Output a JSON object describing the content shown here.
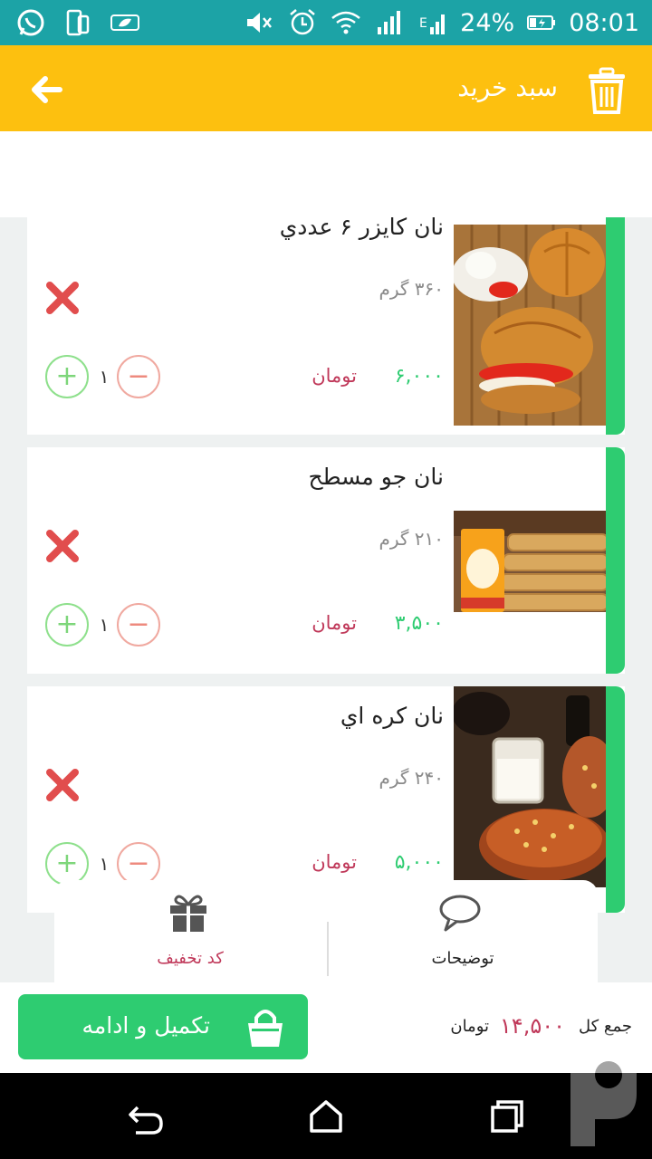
{
  "status_bar": {
    "time": "08:01",
    "battery": "24%",
    "left_icons": [
      "whatsapp-icon",
      "phone-sync-icon",
      "leaf-icon"
    ],
    "right_icons": [
      "mute-icon",
      "alarm-icon",
      "wifi-icon",
      "signal-icon",
      "signal-e-icon",
      "battery-icon"
    ]
  },
  "app_bar": {
    "title": "سبد خرید",
    "back_icon": "arrow-left-icon",
    "delete_icon": "trash-icon"
  },
  "cart": {
    "items": [
      {
        "name": "نان کایزر ۶ عددي",
        "weight": "۳۶۰ گرم",
        "price": "۶,۰۰۰",
        "currency": "تومان",
        "quantity": "۱",
        "image": "kaiser-rolls-image"
      },
      {
        "name": "نان جو مسطح",
        "weight": "۲۱۰ گرم",
        "price": "۳,۵۰۰",
        "currency": "تومان",
        "quantity": "۱",
        "image": "barley-flatbread-image"
      },
      {
        "name": "نان کره اي",
        "weight": "۲۴۰ گرم",
        "price": "۵,۰۰۰",
        "currency": "تومان",
        "quantity": "۱",
        "image": "butter-bread-image"
      }
    ]
  },
  "bottom_panel": {
    "discount_label": "کد تخفیف",
    "notes_label": "توضیحات"
  },
  "checkout": {
    "button_label": "تکمیل و ادامه",
    "total_label": "جمع کل",
    "total_value": "۱۴,۵۰۰",
    "total_currency": "تومان"
  },
  "colors": {
    "status_bar": "#1ca3a6",
    "app_bar": "#fdc00f",
    "accent_green": "#2ecc71",
    "price_red": "#c0395a"
  }
}
